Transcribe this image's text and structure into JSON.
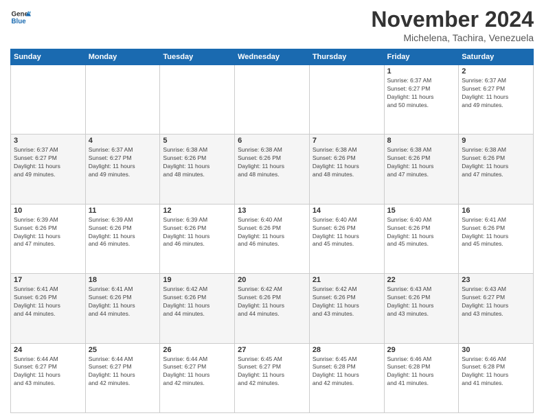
{
  "logo": {
    "general": "General",
    "blue": "Blue"
  },
  "title": "November 2024",
  "location": "Michelena, Tachira, Venezuela",
  "headers": [
    "Sunday",
    "Monday",
    "Tuesday",
    "Wednesday",
    "Thursday",
    "Friday",
    "Saturday"
  ],
  "rows": [
    [
      {
        "day": "",
        "info": ""
      },
      {
        "day": "",
        "info": ""
      },
      {
        "day": "",
        "info": ""
      },
      {
        "day": "",
        "info": ""
      },
      {
        "day": "",
        "info": ""
      },
      {
        "day": "1",
        "info": "Sunrise: 6:37 AM\nSunset: 6:27 PM\nDaylight: 11 hours\nand 50 minutes."
      },
      {
        "day": "2",
        "info": "Sunrise: 6:37 AM\nSunset: 6:27 PM\nDaylight: 11 hours\nand 49 minutes."
      }
    ],
    [
      {
        "day": "3",
        "info": "Sunrise: 6:37 AM\nSunset: 6:27 PM\nDaylight: 11 hours\nand 49 minutes."
      },
      {
        "day": "4",
        "info": "Sunrise: 6:37 AM\nSunset: 6:27 PM\nDaylight: 11 hours\nand 49 minutes."
      },
      {
        "day": "5",
        "info": "Sunrise: 6:38 AM\nSunset: 6:26 PM\nDaylight: 11 hours\nand 48 minutes."
      },
      {
        "day": "6",
        "info": "Sunrise: 6:38 AM\nSunset: 6:26 PM\nDaylight: 11 hours\nand 48 minutes."
      },
      {
        "day": "7",
        "info": "Sunrise: 6:38 AM\nSunset: 6:26 PM\nDaylight: 11 hours\nand 48 minutes."
      },
      {
        "day": "8",
        "info": "Sunrise: 6:38 AM\nSunset: 6:26 PM\nDaylight: 11 hours\nand 47 minutes."
      },
      {
        "day": "9",
        "info": "Sunrise: 6:38 AM\nSunset: 6:26 PM\nDaylight: 11 hours\nand 47 minutes."
      }
    ],
    [
      {
        "day": "10",
        "info": "Sunrise: 6:39 AM\nSunset: 6:26 PM\nDaylight: 11 hours\nand 47 minutes."
      },
      {
        "day": "11",
        "info": "Sunrise: 6:39 AM\nSunset: 6:26 PM\nDaylight: 11 hours\nand 46 minutes."
      },
      {
        "day": "12",
        "info": "Sunrise: 6:39 AM\nSunset: 6:26 PM\nDaylight: 11 hours\nand 46 minutes."
      },
      {
        "day": "13",
        "info": "Sunrise: 6:40 AM\nSunset: 6:26 PM\nDaylight: 11 hours\nand 46 minutes."
      },
      {
        "day": "14",
        "info": "Sunrise: 6:40 AM\nSunset: 6:26 PM\nDaylight: 11 hours\nand 45 minutes."
      },
      {
        "day": "15",
        "info": "Sunrise: 6:40 AM\nSunset: 6:26 PM\nDaylight: 11 hours\nand 45 minutes."
      },
      {
        "day": "16",
        "info": "Sunrise: 6:41 AM\nSunset: 6:26 PM\nDaylight: 11 hours\nand 45 minutes."
      }
    ],
    [
      {
        "day": "17",
        "info": "Sunrise: 6:41 AM\nSunset: 6:26 PM\nDaylight: 11 hours\nand 44 minutes."
      },
      {
        "day": "18",
        "info": "Sunrise: 6:41 AM\nSunset: 6:26 PM\nDaylight: 11 hours\nand 44 minutes."
      },
      {
        "day": "19",
        "info": "Sunrise: 6:42 AM\nSunset: 6:26 PM\nDaylight: 11 hours\nand 44 minutes."
      },
      {
        "day": "20",
        "info": "Sunrise: 6:42 AM\nSunset: 6:26 PM\nDaylight: 11 hours\nand 44 minutes."
      },
      {
        "day": "21",
        "info": "Sunrise: 6:42 AM\nSunset: 6:26 PM\nDaylight: 11 hours\nand 43 minutes."
      },
      {
        "day": "22",
        "info": "Sunrise: 6:43 AM\nSunset: 6:26 PM\nDaylight: 11 hours\nand 43 minutes."
      },
      {
        "day": "23",
        "info": "Sunrise: 6:43 AM\nSunset: 6:27 PM\nDaylight: 11 hours\nand 43 minutes."
      }
    ],
    [
      {
        "day": "24",
        "info": "Sunrise: 6:44 AM\nSunset: 6:27 PM\nDaylight: 11 hours\nand 43 minutes."
      },
      {
        "day": "25",
        "info": "Sunrise: 6:44 AM\nSunset: 6:27 PM\nDaylight: 11 hours\nand 42 minutes."
      },
      {
        "day": "26",
        "info": "Sunrise: 6:44 AM\nSunset: 6:27 PM\nDaylight: 11 hours\nand 42 minutes."
      },
      {
        "day": "27",
        "info": "Sunrise: 6:45 AM\nSunset: 6:27 PM\nDaylight: 11 hours\nand 42 minutes."
      },
      {
        "day": "28",
        "info": "Sunrise: 6:45 AM\nSunset: 6:28 PM\nDaylight: 11 hours\nand 42 minutes."
      },
      {
        "day": "29",
        "info": "Sunrise: 6:46 AM\nSunset: 6:28 PM\nDaylight: 11 hours\nand 41 minutes."
      },
      {
        "day": "30",
        "info": "Sunrise: 6:46 AM\nSunset: 6:28 PM\nDaylight: 11 hours\nand 41 minutes."
      }
    ]
  ]
}
